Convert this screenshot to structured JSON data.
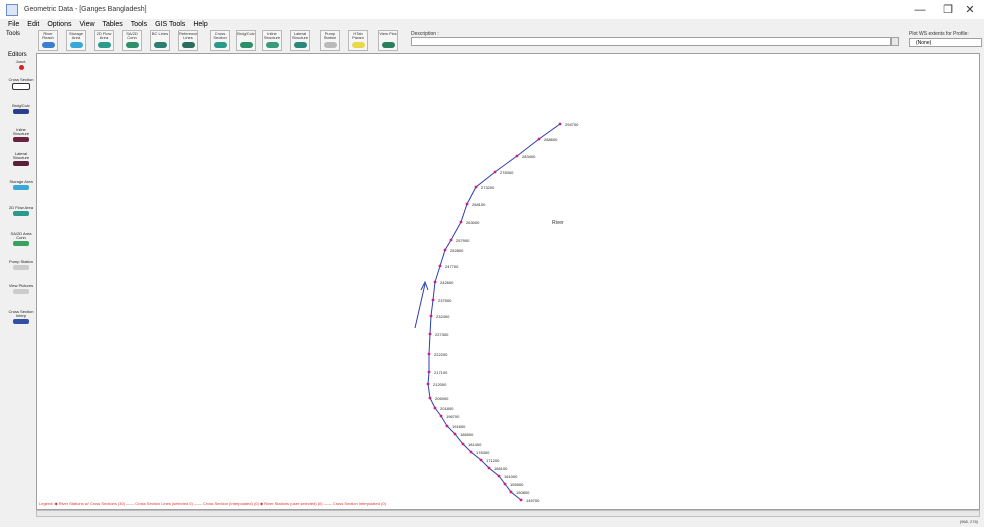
{
  "window": {
    "title": "Geometric Data - [Ganges Bangladesh]",
    "minimize": "—",
    "maximize": "❐",
    "close": "✕"
  },
  "menu": [
    "File",
    "Edit",
    "Options",
    "View",
    "Tables",
    "Tools",
    "GIS Tools",
    "Help"
  ],
  "toolbar": {
    "tools_label": "Tools",
    "buttons": [
      {
        "label": "River Reach",
        "icon": "river-reach-icon"
      },
      {
        "label": "Storage Area",
        "icon": "storage-area-icon"
      },
      {
        "label": "2D Flow Area",
        "icon": "2d-flow-area-icon"
      },
      {
        "label": "SA/2D Conn",
        "icon": "sa-connection-icon"
      },
      {
        "label": "BC Lines",
        "icon": "bc-lines-icon"
      },
      {
        "label": "Reference Lines",
        "icon": "reference-lines-icon"
      },
      {
        "label": "Cross Section",
        "icon": "cross-section-icon"
      },
      {
        "label": "Brdg/Culv",
        "icon": "bridge-culvert-icon"
      },
      {
        "label": "Inline Structure",
        "icon": "inline-structure-icon"
      },
      {
        "label": "Lateral Structure",
        "icon": "lateral-structure-icon"
      },
      {
        "label": "Pump Station",
        "icon": "pump-station-icon"
      },
      {
        "label": "HTab Param",
        "icon": "htab-param-icon"
      },
      {
        "label": "View Pics",
        "icon": "view-pictures-icon"
      }
    ]
  },
  "description": {
    "label": "Description :",
    "value": ""
  },
  "options_panel": {
    "label": "Plot WS extents for Profile:",
    "selected": "(None)"
  },
  "palette": {
    "title": "Editors",
    "items": [
      {
        "label": "Junct.",
        "color": "#d81e1e"
      },
      {
        "label": "Cross Section",
        "color": "#ffffff"
      },
      {
        "label": "Brdg/Culv",
        "color": "#2b3f8a"
      },
      {
        "label": "Inline Structure",
        "color": "#6b2240"
      },
      {
        "label": "Lateral Structure",
        "color": "#5a2038"
      },
      {
        "label": "Storage Area",
        "color": "#38a8d8"
      },
      {
        "label": "2D Flow Area",
        "color": "#2a9a8a"
      },
      {
        "label": "SA/2D Area Conn",
        "color": "#3aa060"
      },
      {
        "label": "Pump Station",
        "color": "#cccccc"
      },
      {
        "label": "View Pictures",
        "color": "#cccccc"
      },
      {
        "label": "Cross Section Interp",
        "color": "#3050a0"
      }
    ]
  },
  "canvas": {
    "river_label": "River",
    "cross_sections": [
      "294700",
      "288600",
      "283400",
      "278300",
      "273200",
      "268100",
      "263000",
      "257900",
      "252800",
      "247700",
      "242600",
      "237500",
      "232400",
      "227300",
      "222200",
      "217100",
      "212000",
      "206900",
      "201800",
      "196700",
      "191600",
      "186500",
      "181400",
      "176300",
      "171200",
      "166100",
      "161000",
      "155900",
      "150800",
      "145700"
    ],
    "legend": "Legend: ◆ River Stations w/ Cross Sections (30)   —— Cross Section Lines (selected 0)   —— Cross Section (Interpolated) (0)   ◆ River Stations (user selected) (0)   —— Cross Section Interpolated (0)"
  },
  "status": {
    "right": "(968, 278)"
  }
}
